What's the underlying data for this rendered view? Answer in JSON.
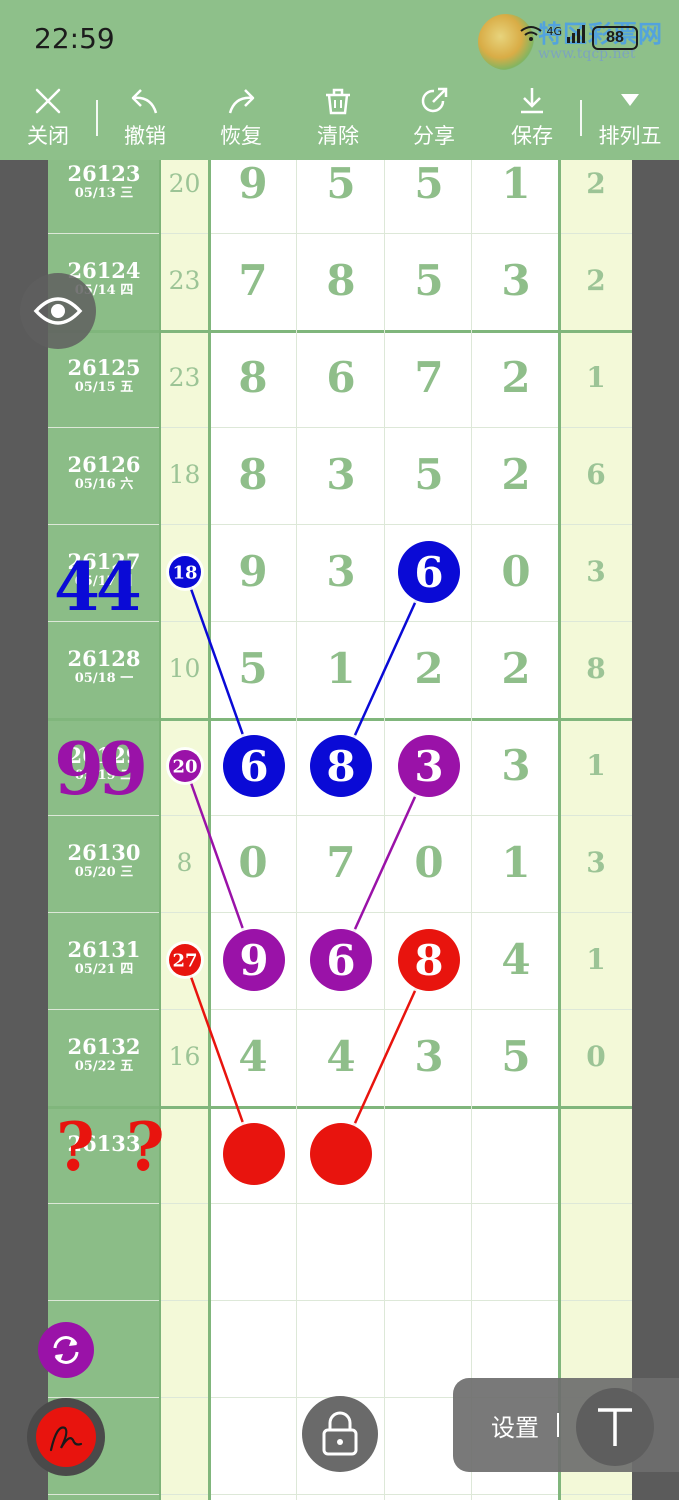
{
  "status_bar": {
    "time": "22:59",
    "network": "4G",
    "battery": "88"
  },
  "watermark": {
    "text": "特区彩票网",
    "url": "www.tqcp.net"
  },
  "toolbar": {
    "close": "关闭",
    "undo": "撤销",
    "redo": "恢复",
    "clear": "清除",
    "share": "分享",
    "save": "保存",
    "lottery": "排列五"
  },
  "rows": [
    {
      "period": "26123",
      "date": "05/13 三",
      "sum": "20",
      "digits": [
        "9",
        "5",
        "5",
        "1"
      ],
      "span": "2"
    },
    {
      "period": "26124",
      "date": "05/14 四",
      "sum": "23",
      "digits": [
        "7",
        "8",
        "5",
        "3"
      ],
      "span": "2"
    },
    {
      "period": "26125",
      "date": "05/15 五",
      "sum": "23",
      "digits": [
        "8",
        "6",
        "7",
        "2"
      ],
      "span": "1"
    },
    {
      "period": "26126",
      "date": "05/16 六",
      "sum": "18",
      "digits": [
        "8",
        "3",
        "5",
        "2"
      ],
      "span": "6"
    },
    {
      "period": "26127",
      "date": "05/17 日",
      "sum": "18",
      "digits": [
        "9",
        "3",
        "6",
        "0"
      ],
      "span": "3"
    },
    {
      "period": "26128",
      "date": "05/18 一",
      "sum": "10",
      "digits": [
        "5",
        "1",
        "2",
        "2"
      ],
      "span": "8"
    },
    {
      "period": "26129",
      "date": "05/19 二",
      "sum": "20",
      "digits": [
        "6",
        "8",
        "3",
        "3"
      ],
      "span": "1"
    },
    {
      "period": "26130",
      "date": "05/20 三",
      "sum": "8",
      "digits": [
        "0",
        "7",
        "0",
        "1"
      ],
      "span": "3"
    },
    {
      "period": "26131",
      "date": "05/21 四",
      "sum": "27",
      "digits": [
        "9",
        "6",
        "8",
        "4"
      ],
      "span": "1"
    },
    {
      "period": "26132",
      "date": "05/22 五",
      "sum": "16",
      "digits": [
        "4",
        "4",
        "3",
        "5"
      ],
      "span": "0"
    },
    {
      "period": "26133",
      "date": "",
      "sum": "",
      "digits": [
        "",
        "",
        "",
        ""
      ],
      "span": ""
    }
  ],
  "annotations": {
    "note_blue": "44",
    "note_purple": "99",
    "note_red_q": "?"
  },
  "colors": {
    "blue": "#0a0ad6",
    "purple": "#9a12a8",
    "red": "#e8140e",
    "header_green": "#8ec08a"
  },
  "icons": [
    "close-icon",
    "undo-icon",
    "redo-icon",
    "clear-icon",
    "share-icon",
    "save-icon",
    "dropdown-icon",
    "eye-icon",
    "refresh-icon",
    "pen-icon",
    "lock-icon",
    "text-tool-icon"
  ],
  "settings": {
    "label": "设置"
  }
}
